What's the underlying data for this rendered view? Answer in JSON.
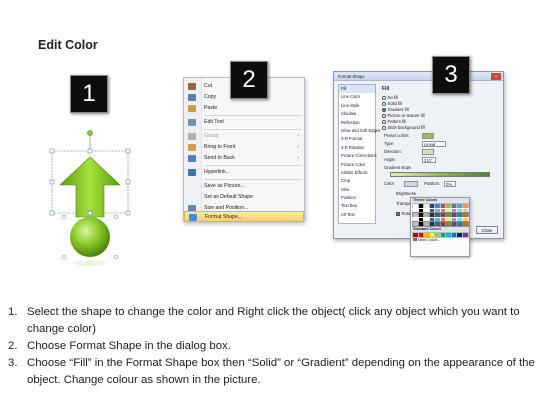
{
  "heading": "Edit Color",
  "badges": [
    "1",
    "2",
    "3"
  ],
  "shape": {
    "color": "#7ec21a",
    "dark": "#4b8a0c",
    "light": "#c4ef6a"
  },
  "context_menu": {
    "items": [
      {
        "label": "Cut",
        "icon": "scissors-icon",
        "color": "#8a6d3b",
        "disabled": false
      },
      {
        "label": "Copy",
        "icon": "copy-icon",
        "color": "#5e80b3",
        "disabled": false
      },
      {
        "label": "Paste",
        "icon": "paste-icon",
        "color": "#c89b3c",
        "disabled": false
      },
      {
        "label": "Edit Text",
        "icon": "edit-text-icon",
        "color": "#7a8fa8",
        "disabled": false
      },
      {
        "label": "Group",
        "icon": "group-icon",
        "color": "#b0b0b0",
        "disabled": true,
        "submenu": true
      },
      {
        "label": "Bring to Front",
        "icon": "bring-front-icon",
        "color": "#d2a040",
        "disabled": false,
        "submenu": true
      },
      {
        "label": "Send to Back",
        "icon": "send-back-icon",
        "color": "#4f7fbf",
        "disabled": false,
        "submenu": true
      },
      {
        "label": "Hyperlink...",
        "icon": "hyperlink-icon",
        "color": "#3a73b6",
        "disabled": false
      },
      {
        "label": "Save as Picture...",
        "icon": "",
        "color": "",
        "disabled": false
      },
      {
        "label": "Set as Default Shape",
        "icon": "",
        "color": "",
        "disabled": false
      },
      {
        "label": "Size and Position...",
        "icon": "size-position-icon",
        "color": "#6d86a6",
        "disabled": false
      },
      {
        "label": "Format Shape...",
        "icon": "format-shape-icon",
        "color": "#4a8ad8",
        "disabled": false
      }
    ]
  },
  "dialog": {
    "title": "Format Shape",
    "nav": [
      "Fill",
      "Line Color",
      "Line Style",
      "Shadow",
      "Reflection",
      "Glow and Soft Edges",
      "3-D Format",
      "3-D Rotation",
      "Picture Corrections",
      "Picture Color",
      "Artistic Effects",
      "Crop",
      "Size",
      "Position",
      "Text Box",
      "Alt Text"
    ],
    "pane_title": "Fill",
    "fill_options": [
      "No fill",
      "Solid fill",
      "Gradient fill",
      "Picture or texture fill",
      "Pattern fill",
      "Slide background fill"
    ],
    "fields": [
      "Preset colors:",
      "Type:",
      "Direction:",
      "Angle:",
      "Gradient stops"
    ],
    "type_value": "Linear",
    "angle_value": "210°",
    "color_label": "Color",
    "position_label": "Position:",
    "position_value": "0%",
    "brightness_label": "Brightness",
    "transparency_label": "Transparency",
    "rotate_label": "Rotate with shape",
    "close_label": "Close",
    "gradient_stop_color": "#8fbf2a"
  },
  "palette": {
    "theme_header": "Theme Colors",
    "standard_header": "Standard Colors",
    "more_label": "More Colors...",
    "theme_colors": [
      "#ffffff",
      "#000000",
      "#eeece1",
      "#1f497d",
      "#4f81bd",
      "#c0504d",
      "#9bbb59",
      "#8064a2",
      "#4bacc6",
      "#f79646"
    ],
    "standard_colors": [
      "#c00000",
      "#ff0000",
      "#ffc000",
      "#ffff00",
      "#92d050",
      "#00b050",
      "#00b0f0",
      "#0070c0",
      "#002060",
      "#7030a0"
    ]
  },
  "steps": [
    {
      "num": "1.",
      "text": "Select the shape to change the color and Right click the object( click any object which you want to change color)"
    },
    {
      "num": "2.",
      "text": "Choose Format Shape in the dialog box."
    },
    {
      "num": "3.",
      "text": "Choose “Fill” in the Format Shape box then “Solid” or “Gradient” depending on the appearance of the object. Change colour as shown in the picture."
    }
  ]
}
